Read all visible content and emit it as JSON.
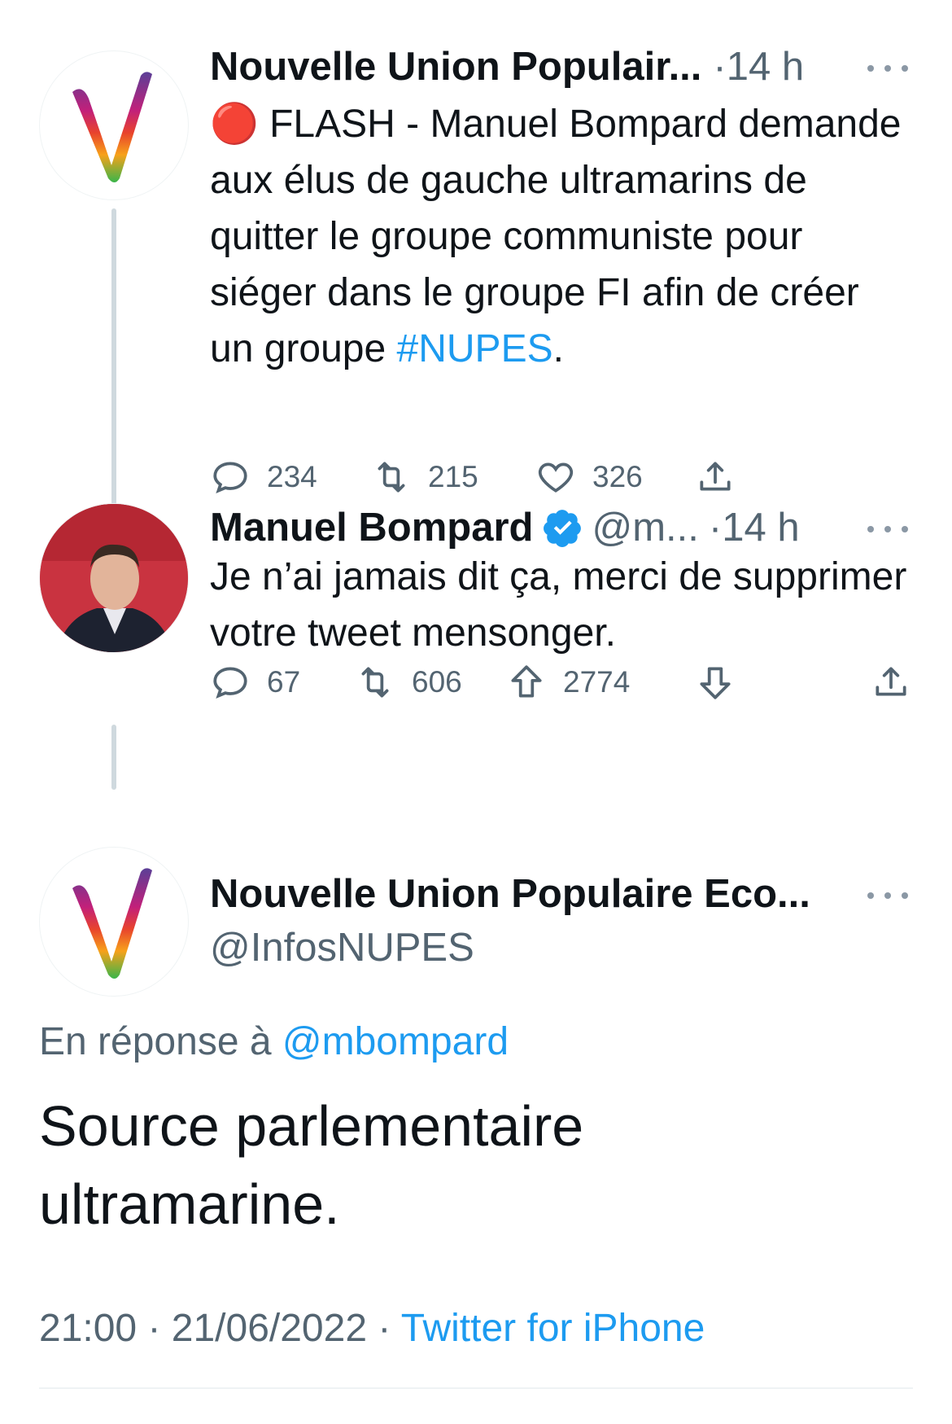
{
  "tweet1": {
    "name": "Nouvelle Union Populair...",
    "time": "·14 h",
    "flash_emoji": "🔴",
    "text": "FLASH - Manuel Bompard demande aux élus de gauche ultramarins de quitter le groupe communiste pour siéger dans le groupe FI afin de créer un groupe",
    "hashtag": "#NUPES",
    "text_end": ".",
    "replies": "234",
    "retweets": "215",
    "likes": "326"
  },
  "tweet2": {
    "name": "Manuel Bompard",
    "handle": "@m...",
    "time": "·14 h",
    "text": "Je n’ai jamais dit ça, merci de supprimer votre tweet mensonger.",
    "replies": "67",
    "retweets": "606",
    "upvotes": "2774"
  },
  "main": {
    "name": "Nouvelle Union Populaire Eco...",
    "handle": "@InfosNUPES",
    "reply_prefix": "En réponse à",
    "reply_handle": "@mbompard",
    "text": "Source parlementaire ultramarine.",
    "timestamp": "21:00 · 21/06/2022 ·",
    "client": "Twitter for iPhone"
  },
  "colors": {
    "link": "#1d9bf0",
    "secondary": "#536471",
    "text": "#0f1419",
    "thread_line": "#cfd9de"
  },
  "icons": [
    "reply-icon",
    "retweet-icon",
    "like-icon",
    "share-icon",
    "upvote-icon",
    "downvote-icon",
    "verified-icon",
    "more-icon",
    "nupes-logo",
    "profile-photo"
  ]
}
